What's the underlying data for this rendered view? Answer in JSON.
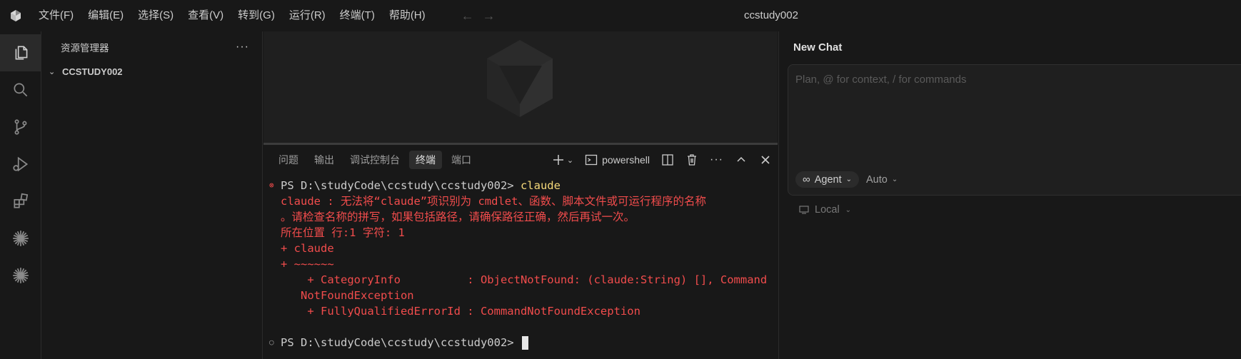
{
  "window": {
    "title": "ccstudy002"
  },
  "menu": [
    "文件(F)",
    "编辑(E)",
    "选择(S)",
    "查看(V)",
    "转到(G)",
    "运行(R)",
    "终端(T)",
    "帮助(H)"
  ],
  "activitybar": [
    "files-icon",
    "search-icon",
    "source-control-icon",
    "run-debug-icon",
    "extensions-icon",
    "sparkle-icon",
    "sparkle-icon"
  ],
  "sidebar": {
    "title": "资源管理器",
    "more": "···",
    "folder": "CCSTUDY002"
  },
  "panel": {
    "tabs": [
      "问题",
      "输出",
      "调试控制台",
      "终端",
      "端口"
    ],
    "active_tab": "终端",
    "shell_label": "powershell"
  },
  "terminal": {
    "prompt1": "PS D:\\studyCode\\ccstudy\\ccstudy002> ",
    "cmd1": "claude",
    "err1": "claude : 无法将“claude”项识别为 cmdlet、函数、脚本文件或可运行程序的名称",
    "err2": "。请检查名称的拼写，如果包括路径，请确保路径正确，然后再试一次。",
    "err3": "所在位置 行:1 字符: 1",
    "err4": "+ claude",
    "err5": "+ ~~~~~~",
    "err6": "    + CategoryInfo          : ObjectNotFound: (claude:String) [], Command",
    "err7": "   NotFoundException",
    "err8": "    + FullyQualifiedErrorId : CommandNotFoundException",
    "prompt2": "PS D:\\studyCode\\ccstudy\\ccstudy002> "
  },
  "chat": {
    "title": "New Chat",
    "placeholder": "Plan, @ for context, / for commands",
    "agent_label": "Agent",
    "auto_label": "Auto",
    "local_label": "Local"
  }
}
